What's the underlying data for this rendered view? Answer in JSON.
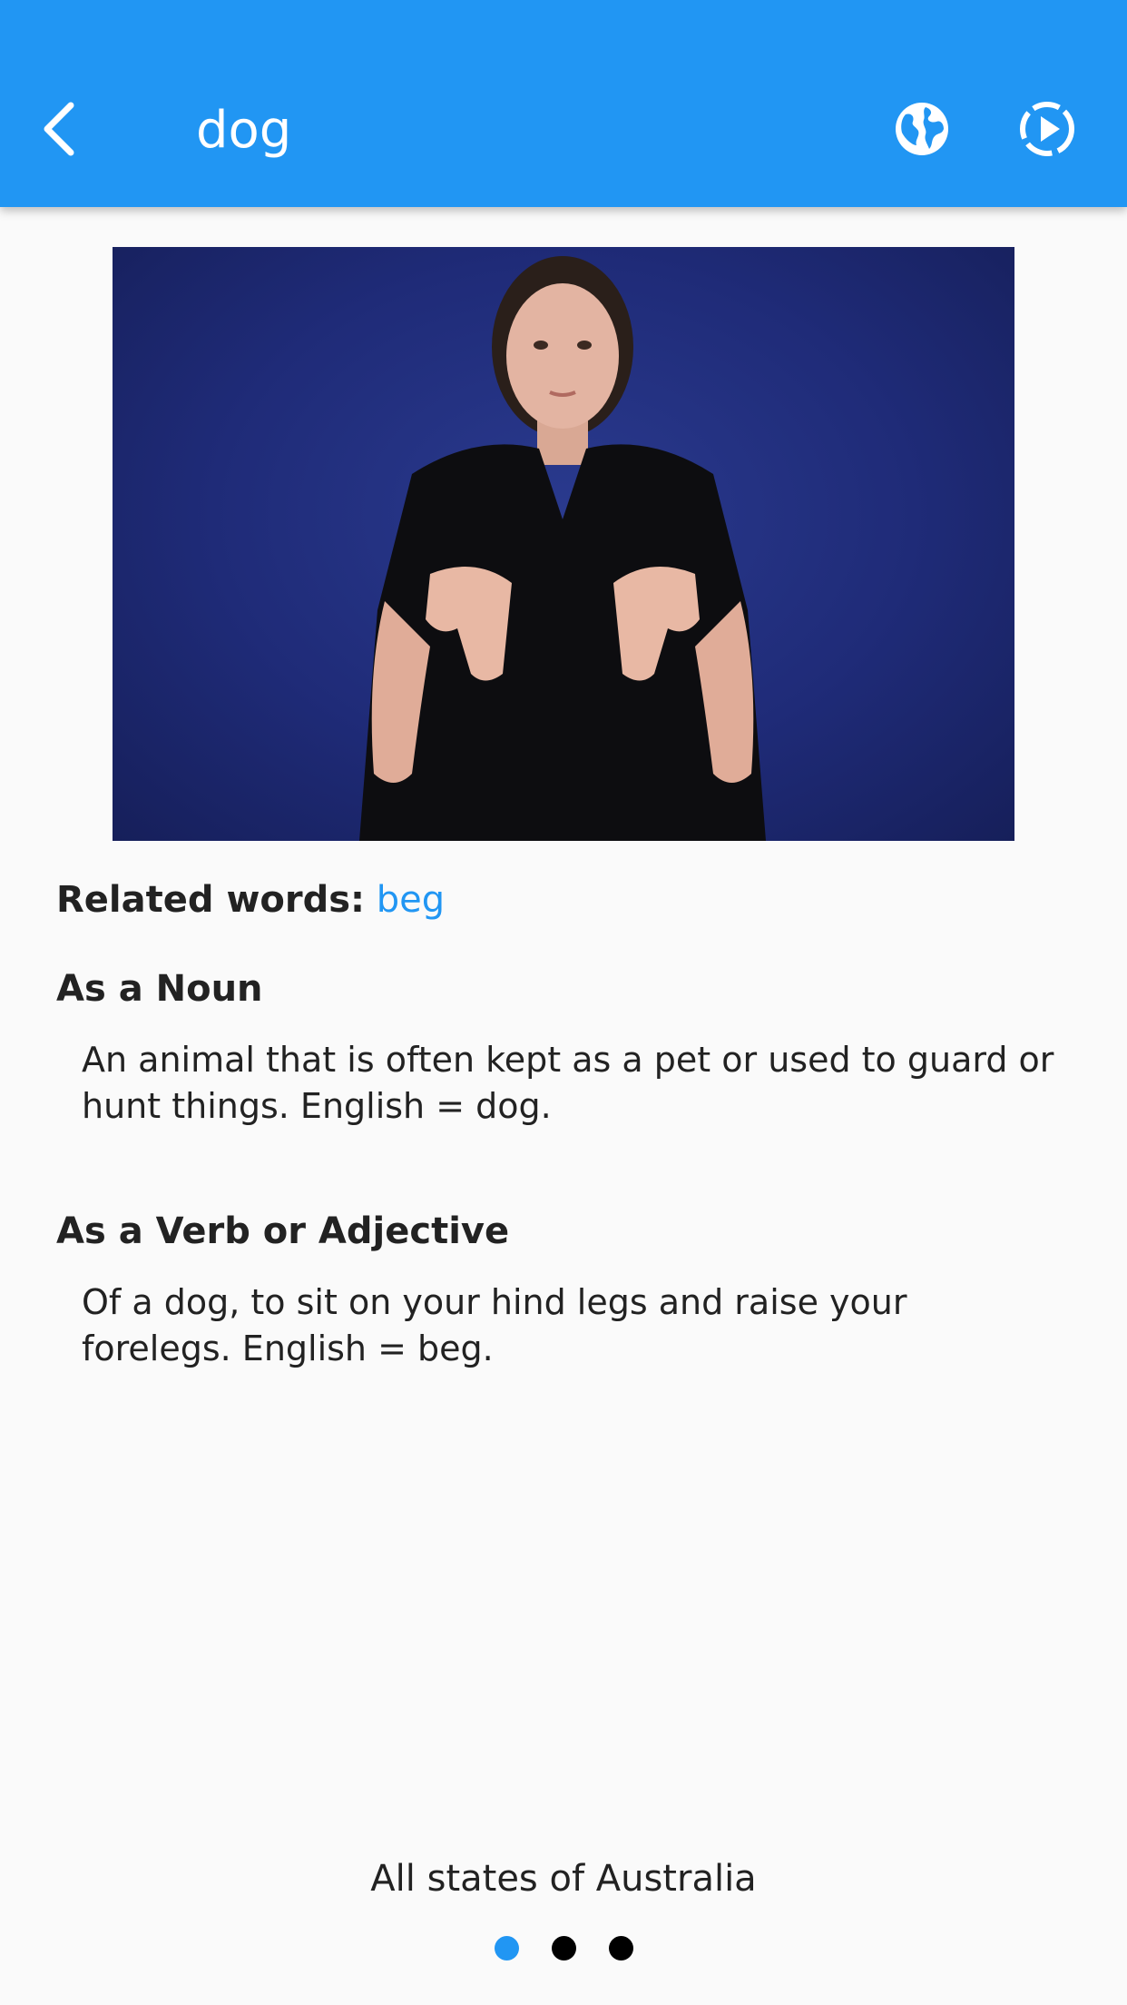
{
  "app_bar": {
    "title": "dog",
    "back_icon": "chevron-left-icon",
    "actions": [
      {
        "name": "globe-icon"
      },
      {
        "name": "play-circle-icon"
      }
    ],
    "color": "#2196f3"
  },
  "video": {
    "background_color": "#1f2b78"
  },
  "related": {
    "label": "Related words:",
    "words": [
      "beg"
    ],
    "link_color": "#2196f3"
  },
  "definitions": [
    {
      "heading": "As a Noun",
      "text": "An animal that is often kept as a pet or used to guard or hunt things. English = dog."
    },
    {
      "heading": "As a Verb or Adjective",
      "text": "Of a dog, to sit on your hind legs and raise your forelegs. English = beg."
    }
  ],
  "region": "All states of Australia",
  "pager": {
    "count": 3,
    "active_index": 0
  }
}
